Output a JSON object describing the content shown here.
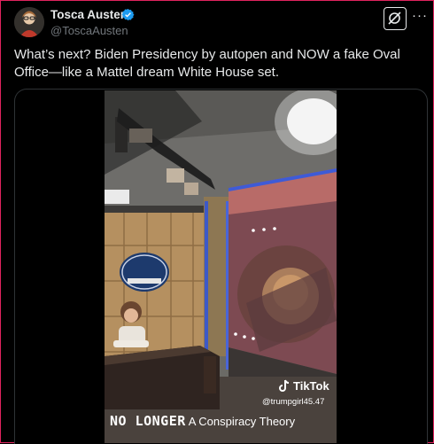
{
  "tweet": {
    "author_name": "Tosca Austen",
    "author_handle": "@ToscaAusten",
    "text": "What’s next? Biden Presidency by autopen and NOW a fake Oval Office—like a Mattel dream White House set.",
    "more_label": "···"
  },
  "video": {
    "watermark_brand": "TikTok",
    "watermark_user": "@trumpgirl45.47",
    "caption_emphasis": "NO LONGER",
    "caption_rest": "A Conspiracy Theory"
  },
  "colors": {
    "background": "#000000",
    "text": "#e7e9ea",
    "secondary_text": "#71767b",
    "verified_badge": "#1d9bf0",
    "frame_border": "#e0245e"
  }
}
